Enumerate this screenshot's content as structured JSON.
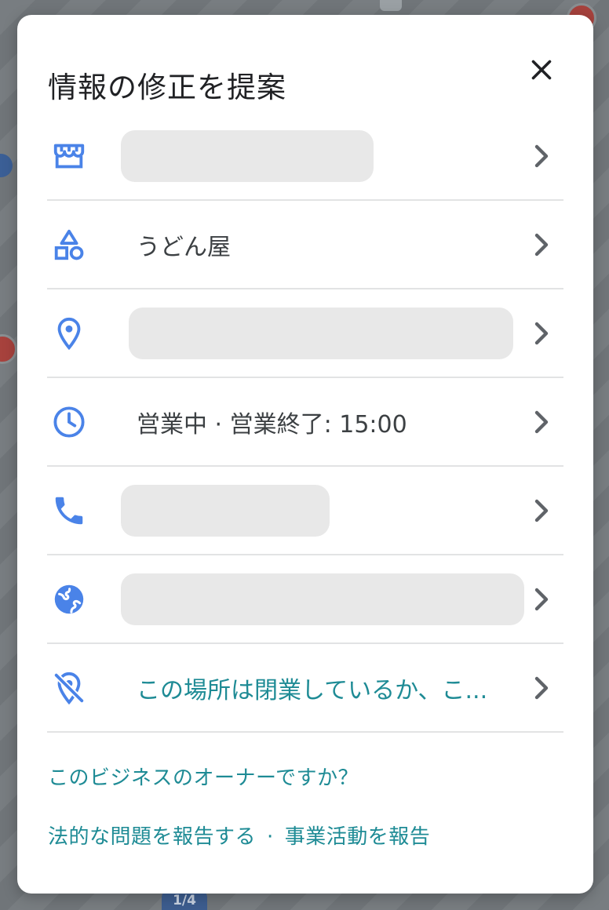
{
  "dialog": {
    "title": "情報の修正を提案",
    "close_icon": "close-icon"
  },
  "rows": [
    {
      "icon": "storefront-icon",
      "text": ""
    },
    {
      "icon": "category-icon",
      "text": "うどん屋"
    },
    {
      "icon": "location-pin-icon",
      "text": ""
    },
    {
      "icon": "clock-icon",
      "text": "営業中 · 営業終了: 15:00"
    },
    {
      "icon": "phone-icon",
      "text": ""
    },
    {
      "icon": "globe-icon",
      "text": ""
    },
    {
      "icon": "location-off-icon",
      "text": "この場所は閉業しているか、こ..."
    }
  ],
  "footer": {
    "owner_link": "このビジネスのオーナーですか？",
    "legal_link": "法的な問題を報告する",
    "separator": "·",
    "business_link": "事業活動を報告"
  },
  "map": {
    "route_shield": "1/4"
  },
  "colors": {
    "icon_blue": "#4a83e8",
    "link_teal": "#1e8b95",
    "text": "#3c4043"
  }
}
